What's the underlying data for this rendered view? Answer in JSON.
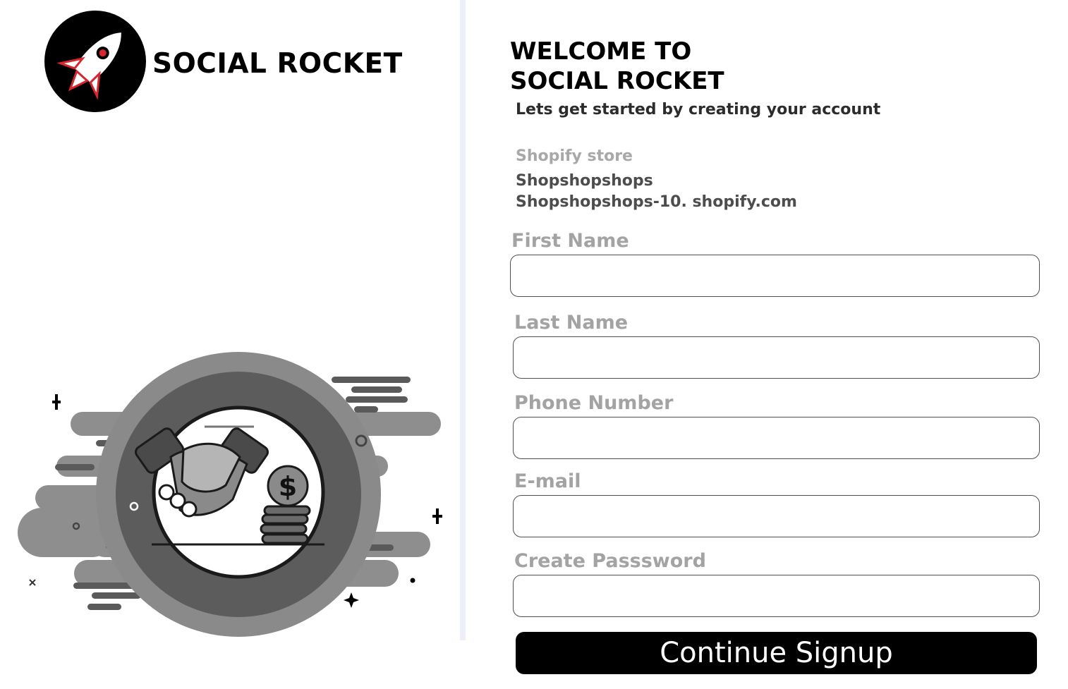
{
  "brand": {
    "name": "SOCIAL ROCKET",
    "logo_icon": "rocket-icon"
  },
  "illustration": {
    "icon": "handshake-money-illustration"
  },
  "form": {
    "welcome_line1": "WELCOME TO",
    "welcome_line2": "SOCIAL ROCKET",
    "subtitle": "Lets get started by creating your account",
    "store_label": "Shopify store",
    "store_name": "Shopshopshops",
    "store_domain": "Shopshopshops-10. shopify.com",
    "fields": [
      {
        "label": "First Name",
        "value": ""
      },
      {
        "label": "Last Name",
        "value": ""
      },
      {
        "label": "Phone Number",
        "value": ""
      },
      {
        "label": "E-mail",
        "value": ""
      },
      {
        "label": "Create Passsword",
        "value": ""
      }
    ],
    "submit_label": "Continue Signup"
  },
  "colors": {
    "divider": "#eceff7",
    "accent_red": "#d7262e",
    "label_gray": "#a3a3a3",
    "button_bg": "#000000"
  }
}
